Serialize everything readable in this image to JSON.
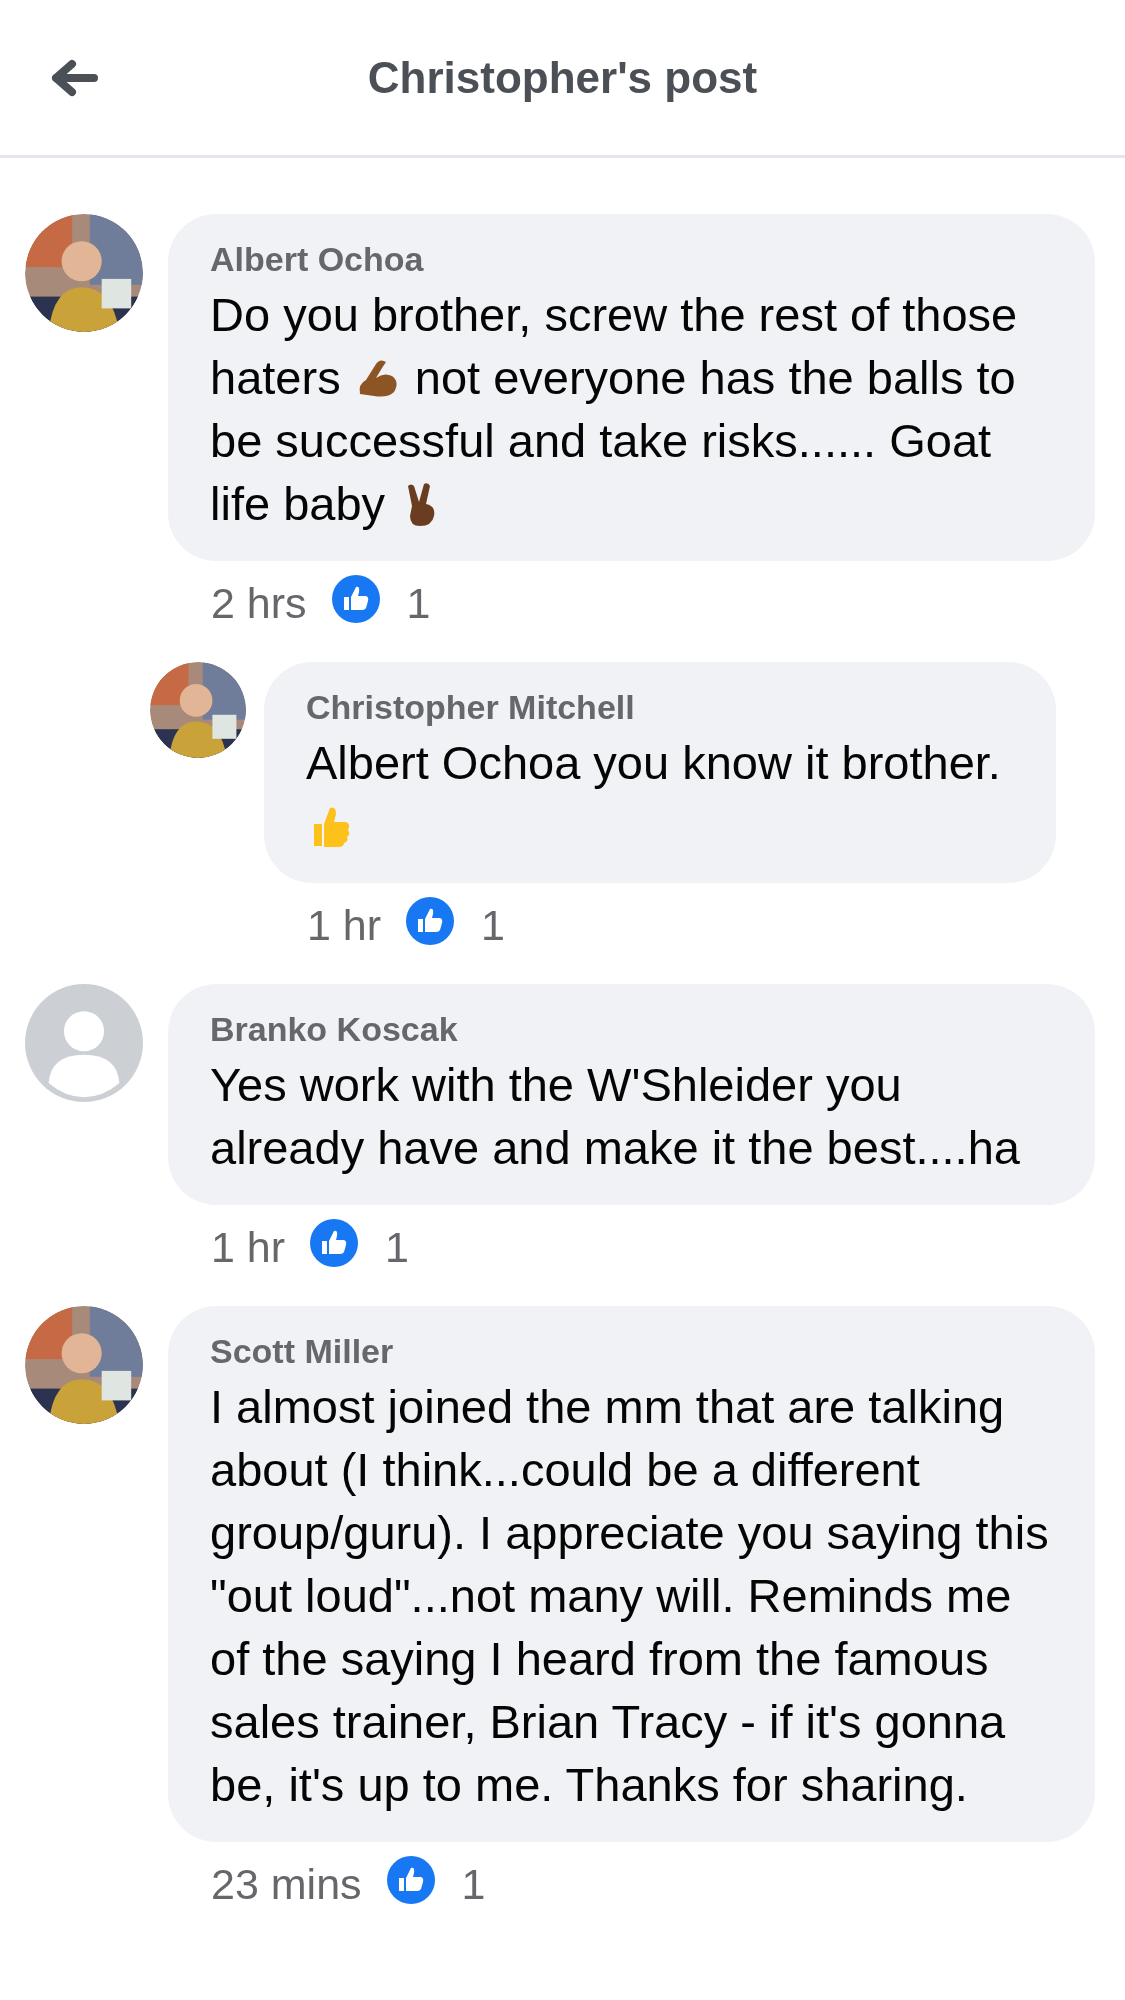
{
  "header": {
    "title": "Christopher's post"
  },
  "comments": [
    {
      "name": "Albert Ochoa",
      "avatar": {
        "kind": "picture"
      },
      "body": [
        {
          "kind": "text",
          "text": "Do you brother, screw the rest of those haters "
        },
        {
          "kind": "biceps"
        },
        {
          "kind": "text",
          "text": " not everyone has the balls to be successful and take risks...... Goat life baby "
        },
        {
          "kind": "victory"
        }
      ],
      "time": "2 hrs",
      "likes": "1",
      "replies": [
        {
          "name": "Christopher Mitchell",
          "avatar": {
            "kind": "picture"
          },
          "body": [
            {
              "kind": "text",
              "text": "Albert Ochoa you know it brother. "
            },
            {
              "kind": "thumbs"
            }
          ],
          "time": "1 hr",
          "likes": "1"
        }
      ]
    },
    {
      "name": "Branko Koscak",
      "avatar": {
        "kind": "default"
      },
      "body": [
        {
          "kind": "text",
          "text": "Yes work with the W'Shleider you already have and make it the best....ha"
        }
      ],
      "time": "1 hr",
      "likes": "1"
    },
    {
      "name": "Scott Miller",
      "avatar": {
        "kind": "picture"
      },
      "body": [
        {
          "kind": "text",
          "text": "I almost joined the mm that are talking about (I think...could be a different group/guru).  I appreciate you saying this \"out loud\"...not many will.  Reminds me of the saying I heard from the famous sales trainer, Brian Tracy - if it's gonna be, it's up to me. Thanks for sharing."
        }
      ],
      "time": "23 mins",
      "likes": "1"
    }
  ]
}
